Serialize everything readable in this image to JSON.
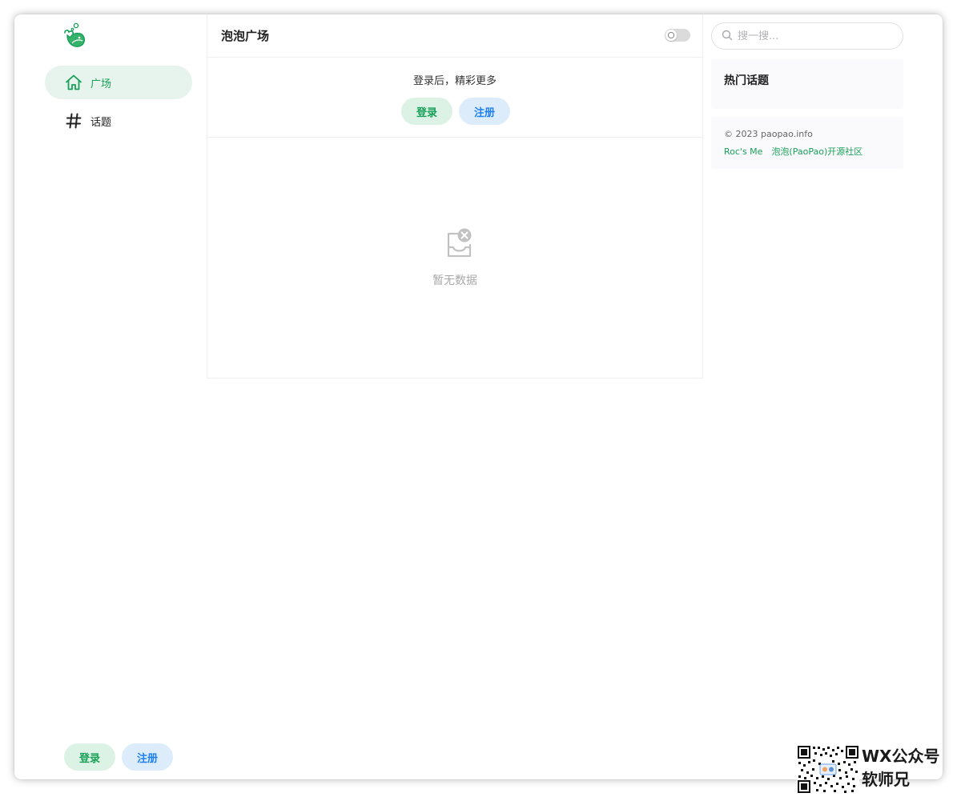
{
  "brand": {
    "accent": "#18a058",
    "secondary": "#2080f0"
  },
  "sidebar": {
    "logo_icon": "paopao-whale-logo-icon",
    "items": [
      {
        "label": "广场",
        "icon": "home-icon",
        "active": true
      },
      {
        "label": "话题",
        "icon": "hash-icon",
        "active": false
      }
    ],
    "login_label": "登录",
    "register_label": "注册"
  },
  "header": {
    "title": "泡泡广场",
    "theme_toggle_icon": "moon-icon"
  },
  "auth_prompt": {
    "text": "登录后，精彩更多",
    "login_label": "登录",
    "register_label": "注册"
  },
  "empty_state": {
    "icon": "empty-inbox-icon",
    "text": "暂无数据"
  },
  "search": {
    "placeholder": "搜一搜..."
  },
  "hot_topics": {
    "title": "热门话题"
  },
  "footer": {
    "copyright": "© 2023 paopao.info",
    "links": [
      "Roc's Me",
      "泡泡(PaoPao)开源社区"
    ]
  },
  "watermark": {
    "line1": "WX公众号",
    "line2": "软师兄"
  }
}
